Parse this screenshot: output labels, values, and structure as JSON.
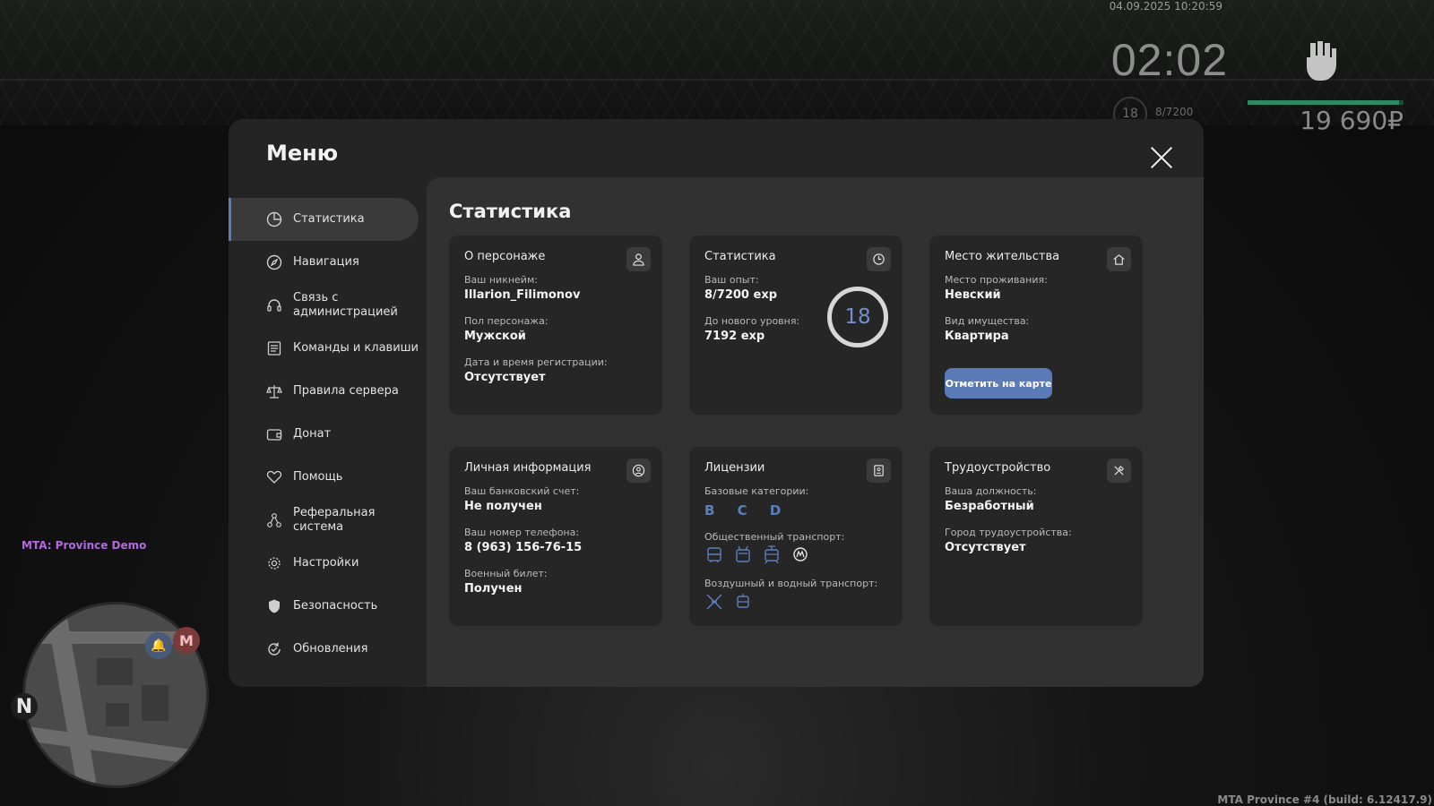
{
  "hud": {
    "datetime": "04.09.2025 10:20:59",
    "time": "02:02",
    "level": "18",
    "exp": "8/7200",
    "health_fraction": 0.97,
    "money": "19 690₽",
    "server_tag": "MTA: Province Demo",
    "build": "MTA Province #4 (build: 6.12417.9)",
    "minimap": {
      "north": "N",
      "metro": "M"
    }
  },
  "menu": {
    "title": "Меню",
    "nav": [
      {
        "label": "Статистика",
        "icon": "pie-chart-icon",
        "active": true
      },
      {
        "label": "Навигация",
        "icon": "compass-icon"
      },
      {
        "label": "Связь с администрацией",
        "icon": "headset-icon"
      },
      {
        "label": "Команды и клавиши",
        "icon": "list-icon"
      },
      {
        "label": "Правила сервера",
        "icon": "scales-icon"
      },
      {
        "label": "Донат",
        "icon": "wallet-icon"
      },
      {
        "label": "Помощь",
        "icon": "handshake-icon"
      },
      {
        "label": "Реферальная система",
        "icon": "referral-icon"
      },
      {
        "label": "Настройки",
        "icon": "gear-icon"
      },
      {
        "label": "Безопасность",
        "icon": "shield-icon"
      },
      {
        "label": "Обновления",
        "icon": "refresh-icon"
      }
    ]
  },
  "stats": {
    "title": "Статистика",
    "character": {
      "title": "О персонаже",
      "nickname_label": "Ваш никнейм:",
      "nickname": "Illarion_Filimonov",
      "gender_label": "Пол персонажа:",
      "gender": "Мужской",
      "reg_label": "Дата и время регистрации:",
      "reg": "Отсутствует"
    },
    "statistics": {
      "title": "Статистика",
      "exp_label": "Ваш опыт:",
      "exp": "8/7200 exp",
      "next_label": "До нового уровня:",
      "next": "7192 exp",
      "level": "18"
    },
    "residence": {
      "title": "Место жительства",
      "place_label": "Место проживания:",
      "place": "Невский",
      "property_label": "Вид имущества:",
      "property": "Квартира",
      "button": "Отметить на карте"
    },
    "personal": {
      "title": "Личная информация",
      "bank_label": "Ваш банковский счет:",
      "bank": "Не получен",
      "phone_label": "Ваш номер телефона:",
      "phone": "8 (963) 156-76-15",
      "military_label": "Военный билет:",
      "military": "Получен"
    },
    "licenses": {
      "title": "Лицензии",
      "base_label": "Базовые категории:",
      "base": "B C D",
      "public_label": "Общественный транспорт:",
      "public_icons": [
        "bus-icon",
        "trolleybus-icon",
        "tram-icon",
        "metro-icon"
      ],
      "air_label": "Воздушный и водный транспорт:",
      "air_icons": [
        "plane-icon",
        "boat-icon"
      ]
    },
    "employment": {
      "title": "Трудоустройство",
      "position_label": "Ваша должность:",
      "position": "Безработный",
      "city_label": "Город трудоустройства:",
      "city": "Отсутствует"
    }
  },
  "colors": {
    "accent": "#5b7fbd",
    "panel": "#242424",
    "content": "#313131",
    "card": "#262626"
  }
}
